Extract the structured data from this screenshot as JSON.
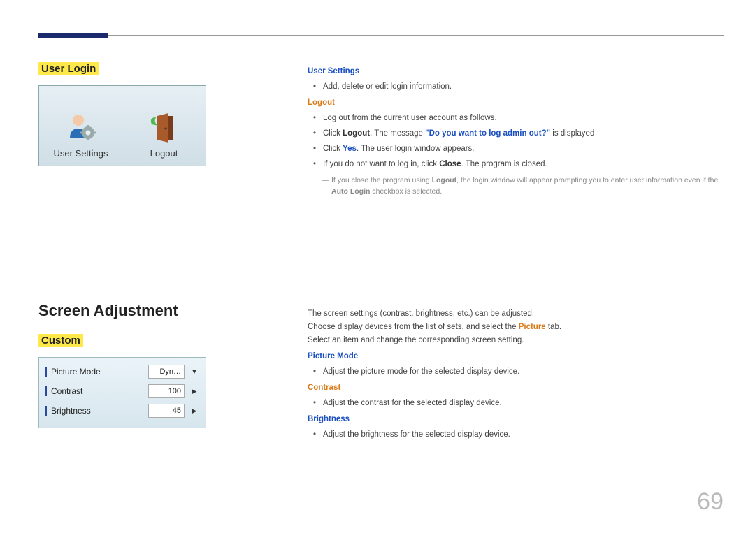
{
  "page_number": "69",
  "section1": {
    "heading": "User Login",
    "screenshot": {
      "item1_label": "User Settings",
      "item2_label": "Logout"
    },
    "right": {
      "h_user_settings": "User Settings",
      "us_b1": "Add, delete or edit login information.",
      "h_logout": "Logout",
      "lo_b1": "Log out from the current user account as follows.",
      "lo_b2_pre": "Click ",
      "lo_b2_logout": "Logout",
      "lo_b2_mid": ". The message ",
      "lo_b2_msg": "\"Do you want to log admin out?\"",
      "lo_b2_post": " is displayed",
      "lo_b3_pre": "Click ",
      "lo_b3_yes": "Yes",
      "lo_b3_post": ". The user login window appears.",
      "lo_b4_pre": "If you do not want to log in, click ",
      "lo_b4_close": "Close",
      "lo_b4_post": ". The program is closed.",
      "note_pre": "If you close the program using ",
      "note_logout": "Logout",
      "note_mid": ", the login window will appear prompting you to enter user information even if the ",
      "note_auto": "Auto Login",
      "note_post": " checkbox is selected."
    }
  },
  "section2": {
    "heading_main": "Screen Adjustment",
    "heading": "Custom",
    "screenshot": {
      "row1_label": "Picture Mode",
      "row1_value": "Dyn…",
      "row2_label": "Contrast",
      "row2_value": "100",
      "row3_label": "Brightness",
      "row3_value": "45"
    },
    "right": {
      "p1": "The screen settings (contrast, brightness, etc.) can be adjusted.",
      "p2_pre": "Choose display devices from the list of sets, and select the ",
      "p2_picture": "Picture",
      "p2_post": " tab.",
      "p3": "Select an item and change the corresponding screen setting.",
      "h_pm": "Picture Mode",
      "pm_b1": "Adjust the picture mode for the selected display device.",
      "h_contrast": "Contrast",
      "co_b1": "Adjust the contrast for the selected display device.",
      "h_brightness": "Brightness",
      "br_b1": "Adjust the brightness for the selected display device."
    }
  }
}
